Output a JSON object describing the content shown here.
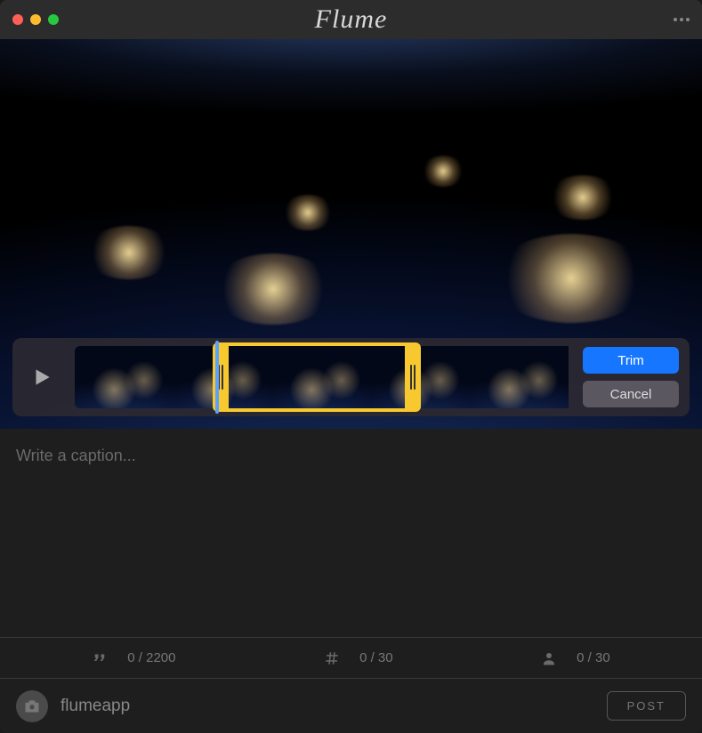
{
  "app": {
    "title": "Flume"
  },
  "video": {
    "trim": {
      "trim_label": "Trim",
      "cancel_label": "Cancel",
      "selection_start_pct": 28,
      "selection_end_pct": 70,
      "playhead_pct": 28.5
    }
  },
  "caption": {
    "placeholder": "Write a caption...",
    "value": ""
  },
  "counts": {
    "caption": "0 / 2200",
    "hashtags": "0 / 30",
    "mentions": "0 / 30"
  },
  "footer": {
    "username": "flumeapp",
    "post_label": "POST"
  }
}
